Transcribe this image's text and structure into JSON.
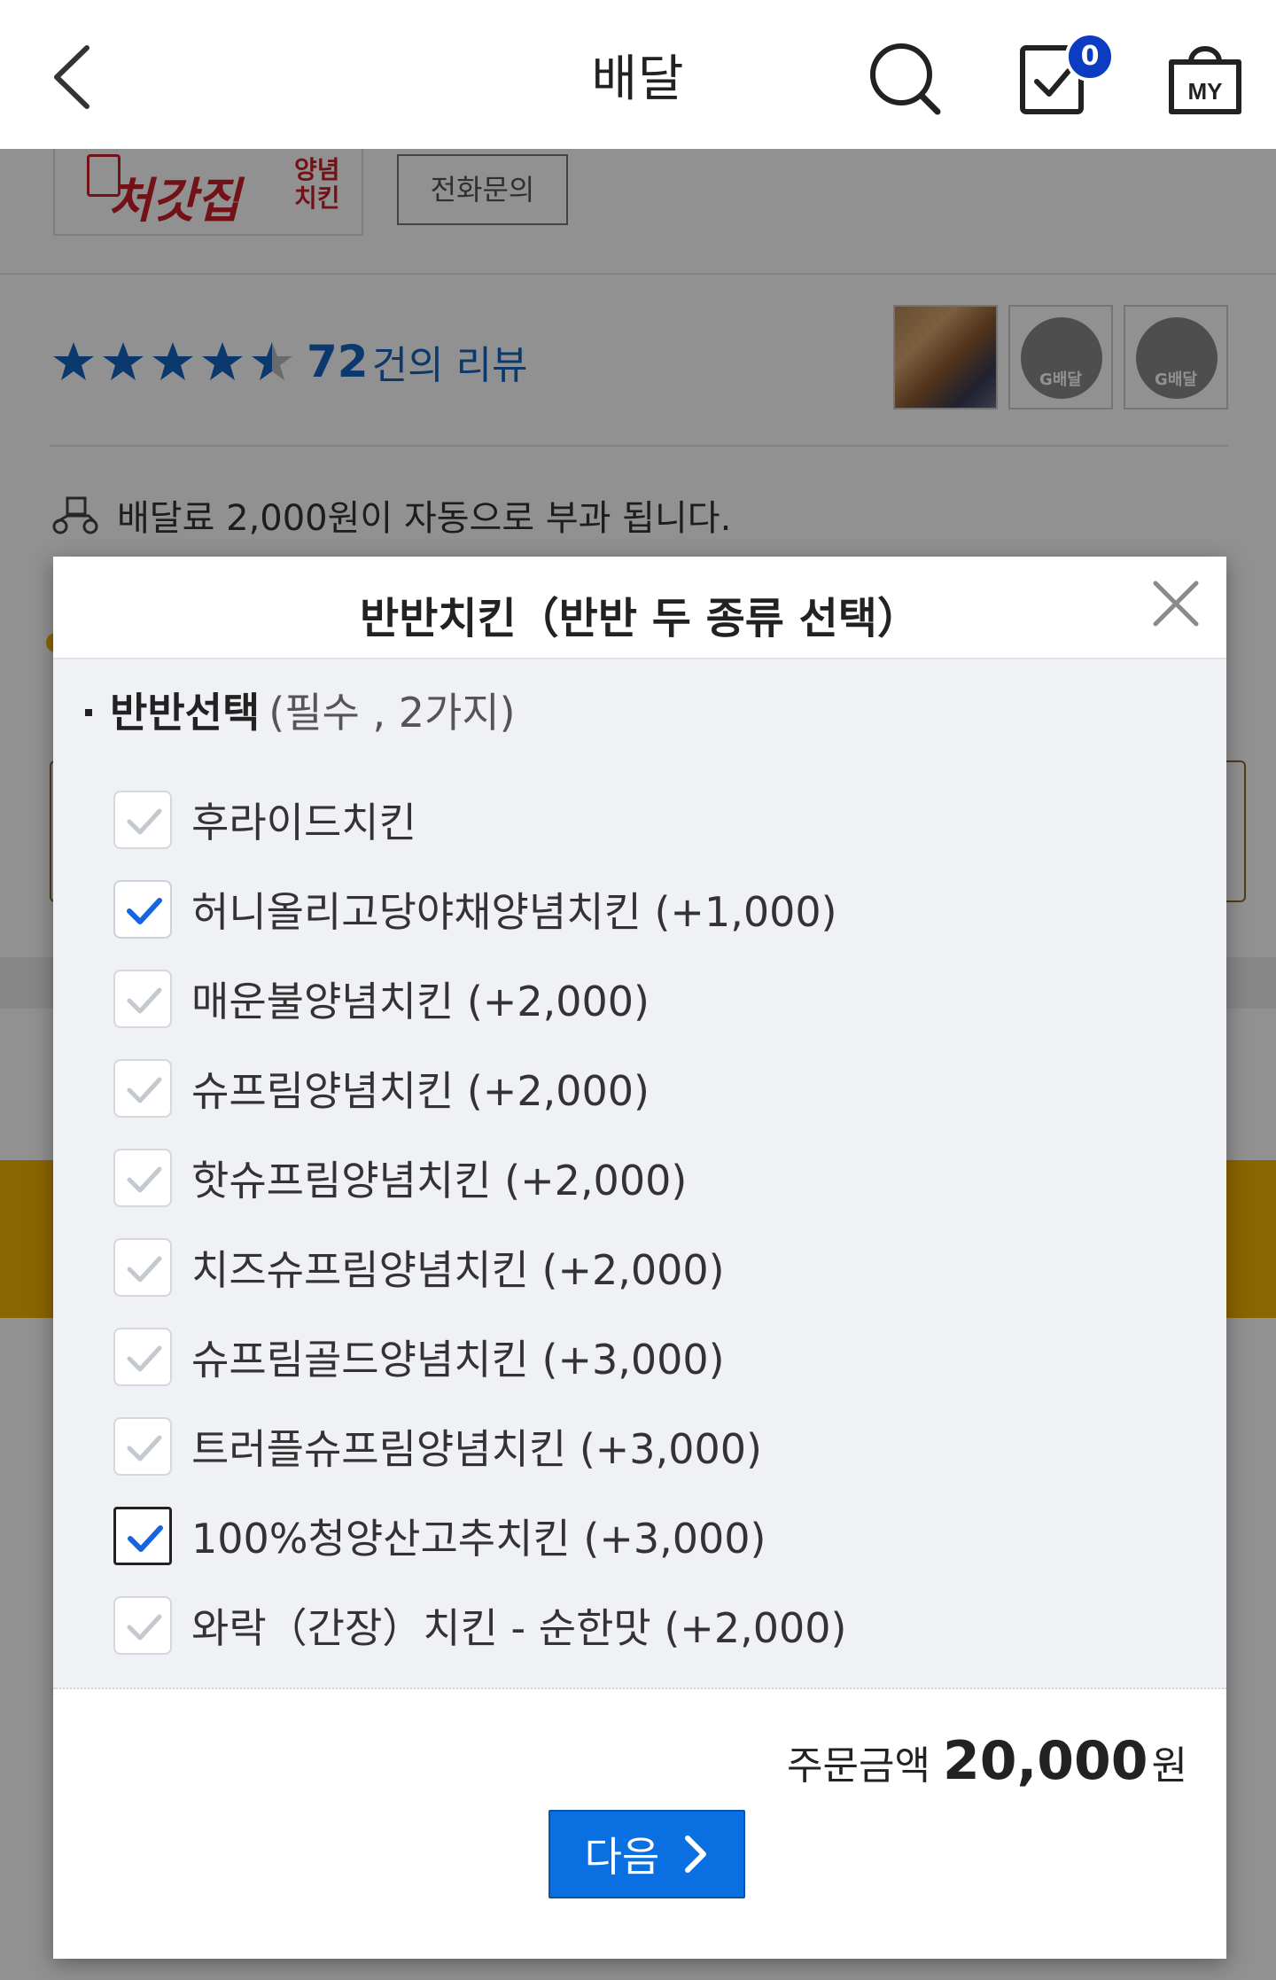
{
  "header": {
    "title": "배달",
    "cart_count": "0",
    "my_label": "MY"
  },
  "store": {
    "logo_name": "처갓집",
    "logo_sub_1": "양념",
    "logo_sub_2": "치킨",
    "phone_button": "전화문의",
    "rating": 4.5,
    "review_count": "72",
    "review_label": "건의 리뷰",
    "thumb_badge": "G배달",
    "delivery_note": "배달료 2,000원이 자동으로 부과 됩니다."
  },
  "modal": {
    "title": "반반치킨（반반 두 종류 선택）",
    "section_name": "반반선택",
    "section_req": "(필수 , 2가지)",
    "options": [
      {
        "label": "후라이드치킨",
        "checked": false
      },
      {
        "label": "허니올리고당야채양념치킨 (+1,000)",
        "checked": true
      },
      {
        "label": "매운불양념치킨 (+2,000)",
        "checked": false
      },
      {
        "label": "슈프림양념치킨 (+2,000)",
        "checked": false
      },
      {
        "label": "핫슈프림양념치킨 (+2,000)",
        "checked": false
      },
      {
        "label": "치즈슈프림양념치킨 (+2,000)",
        "checked": false
      },
      {
        "label": "슈프림골드양념치킨 (+3,000)",
        "checked": false
      },
      {
        "label": "트러플슈프림양념치킨 (+3,000)",
        "checked": false
      },
      {
        "label": "100%청양산고추치킨 (+3,000)",
        "checked": true,
        "focused": true
      },
      {
        "label": "와락（간장）치킨 - 순한맛 (+2,000)",
        "checked": false
      }
    ],
    "total_label": "주문금액",
    "total_amount": "20,000",
    "total_unit": "원",
    "next_label": "다음"
  },
  "colors": {
    "accent": "#0a6fe0",
    "check_on": "#1565e0",
    "check_off": "#c4c9d0",
    "rating_star": "#1565c0",
    "badge": "#0b3cc1"
  }
}
